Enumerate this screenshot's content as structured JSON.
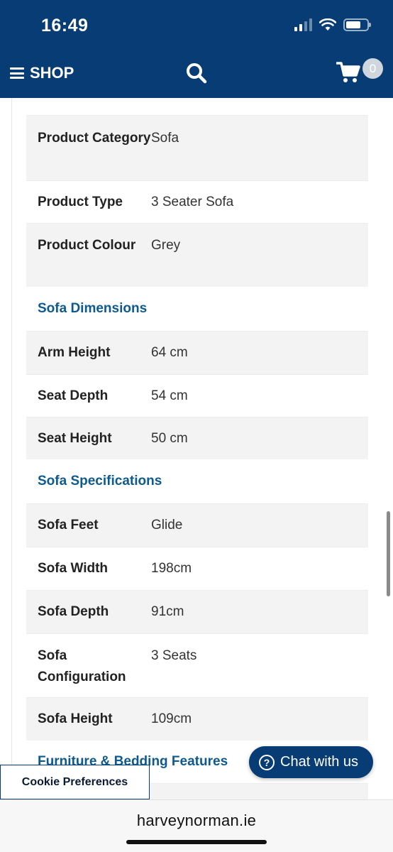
{
  "status_bar": {
    "time": "16:49"
  },
  "header": {
    "shop_label": "SHOP",
    "cart_count": "0"
  },
  "specs": {
    "r0": {
      "label": "Product Category",
      "value": "Sofa"
    },
    "r1": {
      "label": "Product Type",
      "value": "3 Seater Sofa"
    },
    "r2": {
      "label": "Product Colour",
      "value": "Grey"
    },
    "s1": "Sofa Dimensions",
    "r3": {
      "label": "Arm Height",
      "value": "64 cm"
    },
    "r4": {
      "label": "Seat Depth",
      "value": "54 cm"
    },
    "r5": {
      "label": "Seat Height",
      "value": "50 cm"
    },
    "s2": "Sofa Specifications",
    "r6": {
      "label": "Sofa Feet",
      "value": "Glide"
    },
    "r7": {
      "label": "Sofa Width",
      "value": "198cm"
    },
    "r8": {
      "label": "Sofa Depth",
      "value": "91cm"
    },
    "r9": {
      "label": "Sofa Configuration",
      "value": "3 Seats"
    },
    "r10": {
      "label": "Sofa Height",
      "value": "109cm"
    },
    "s3": "Furniture & Bedding Features"
  },
  "chat": {
    "label": "Chat with us"
  },
  "cookie": {
    "label": "Cookie Preferences"
  },
  "browser": {
    "url": "harveynorman.ie"
  },
  "colors": {
    "brand": "#073c74",
    "section": "#0d5a8f",
    "row_shade": "#f3f3f3"
  }
}
